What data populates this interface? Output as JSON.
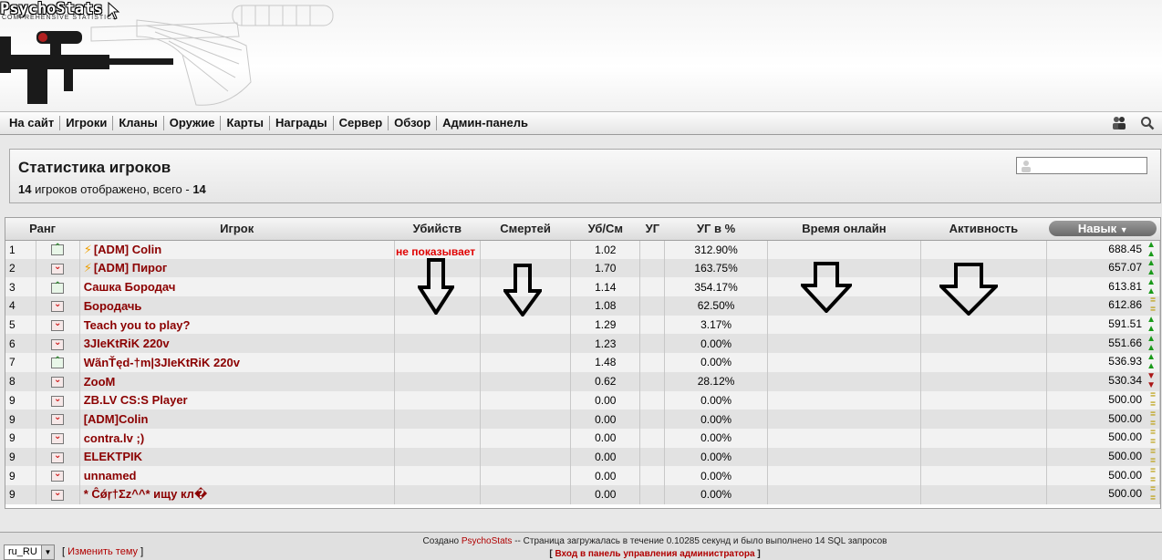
{
  "header": {
    "logo_text": "PsychoStats",
    "logo_sub": "COMPREHENSIVE STATISTICS"
  },
  "nav": {
    "items": [
      "На сайт",
      "Игроки",
      "Кланы",
      "Оружие",
      "Карты",
      "Награды",
      "Сервер",
      "Обзор",
      "Админ-панель"
    ],
    "icons": [
      "users-icon",
      "search-icon"
    ]
  },
  "stats": {
    "title": "Статистика игроков",
    "shown_count": "14",
    "sub_middle": " игроков отображено, всего - ",
    "total_count": "14"
  },
  "table": {
    "headers": [
      "Ранг",
      "Игрок",
      "Убийств",
      "Смертей",
      "Уб/См",
      "УГ",
      "УГ в %",
      "Время онлайн",
      "Активность",
      "Навык"
    ],
    "rows": [
      {
        "rank": "1",
        "change": "up",
        "name": "[ADM] Colin",
        "admin": true,
        "kd": "1.02",
        "hsp": "312.90%",
        "skill": "688.45",
        "trend": "up"
      },
      {
        "rank": "2",
        "change": "down",
        "name": "[ADM] Пирог",
        "admin": true,
        "kd": "1.70",
        "hsp": "163.75%",
        "skill": "657.07",
        "trend": "up"
      },
      {
        "rank": "3",
        "change": "up",
        "name": "Сашка Бородач",
        "admin": false,
        "kd": "1.14",
        "hsp": "354.17%",
        "skill": "613.81",
        "trend": "up"
      },
      {
        "rank": "4",
        "change": "down",
        "name": "Бородачь",
        "admin": false,
        "kd": "1.08",
        "hsp": "62.50%",
        "skill": "612.86",
        "trend": "same"
      },
      {
        "rank": "5",
        "change": "down",
        "name": "Teach you to play?",
        "admin": false,
        "kd": "1.29",
        "hsp": "3.17%",
        "skill": "591.51",
        "trend": "up"
      },
      {
        "rank": "6",
        "change": "down",
        "name": "3JIeKtRiK 220v",
        "admin": false,
        "kd": "1.23",
        "hsp": "0.00%",
        "skill": "551.66",
        "trend": "up"
      },
      {
        "rank": "7",
        "change": "up",
        "name": "WãnŤęd-†m|3JIeKtRiK 220v",
        "admin": false,
        "kd": "1.48",
        "hsp": "0.00%",
        "skill": "536.93",
        "trend": "up"
      },
      {
        "rank": "8",
        "change": "down",
        "name": "ZooM",
        "admin": false,
        "kd": "0.62",
        "hsp": "28.12%",
        "skill": "530.34",
        "trend": "down"
      },
      {
        "rank": "9",
        "change": "down",
        "name": "ZB.LV CS:S Player",
        "admin": false,
        "kd": "0.00",
        "hsp": "0.00%",
        "skill": "500.00",
        "trend": "same"
      },
      {
        "rank": "9",
        "change": "down",
        "name": "[ADM]Colin",
        "admin": false,
        "kd": "0.00",
        "hsp": "0.00%",
        "skill": "500.00",
        "trend": "same"
      },
      {
        "rank": "9",
        "change": "down",
        "name": "contra.lv ;)",
        "admin": false,
        "kd": "0.00",
        "hsp": "0.00%",
        "skill": "500.00",
        "trend": "same"
      },
      {
        "rank": "9",
        "change": "down",
        "name": "ELEKTPIK",
        "admin": false,
        "kd": "0.00",
        "hsp": "0.00%",
        "skill": "500.00",
        "trend": "same"
      },
      {
        "rank": "9",
        "change": "down",
        "name": "unnamed",
        "admin": false,
        "kd": "0.00",
        "hsp": "0.00%",
        "skill": "500.00",
        "trend": "same"
      },
      {
        "rank": "9",
        "change": "down",
        "name": "* Ĉǿŗ†Σz^^* ищу кл�",
        "admin": false,
        "kd": "0.00",
        "hsp": "0.00%",
        "skill": "500.00",
        "trend": "same"
      }
    ]
  },
  "annotation": {
    "text": "не показывает"
  },
  "footer": {
    "created_prefix": "Создано ",
    "created_link": "PsychoStats",
    "created_suffix": " -- Страница загружалась в течение 0.10285 секунд и было выполнено 14 SQL запросов",
    "admin_link": "Вход в панель управления администратора",
    "lang_value": "ru_RU",
    "change_theme": "Изменить тему"
  }
}
